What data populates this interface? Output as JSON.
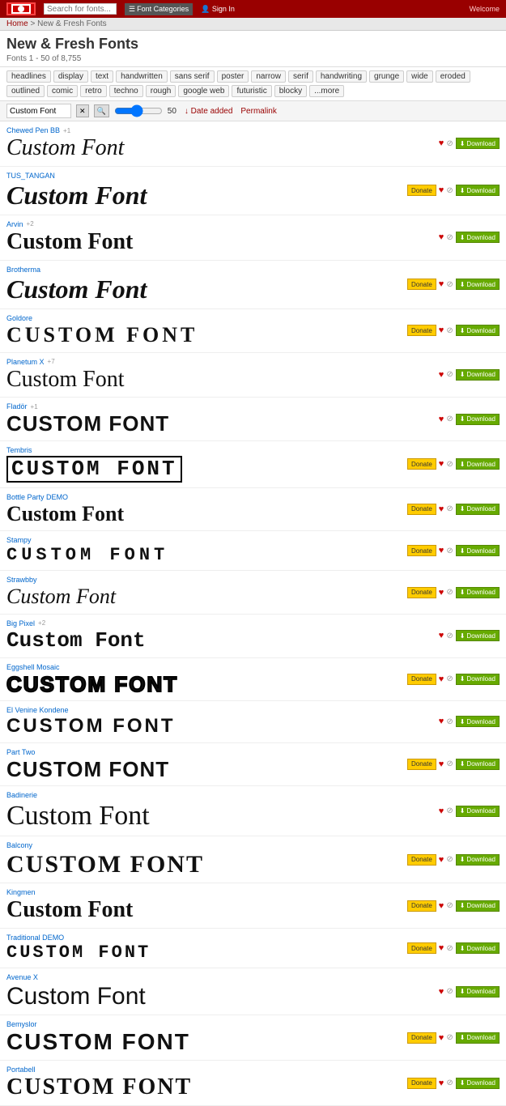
{
  "header": {
    "search_placeholder": "Search for fonts...",
    "font_categories_label": "Font Categories",
    "sign_in_label": "Sign In",
    "welcome_text": "Welcome"
  },
  "breadcrumb": {
    "home": "Home",
    "separator": " > ",
    "current": "New & Fresh Fonts"
  },
  "page": {
    "title": "New & Fresh Fonts",
    "subtitle": "Fonts 1 - 50 of 8,755"
  },
  "filters": {
    "tags": [
      "headlines",
      "display",
      "text",
      "handwritten",
      "sans serif",
      "poster",
      "narrow",
      "serif",
      "handwriting",
      "grunge",
      "wide",
      "eroded",
      "outlined",
      "comic",
      "retro",
      "techno",
      "rough",
      "google web",
      "futuristic",
      "blocky",
      "...more"
    ]
  },
  "toolbar": {
    "preview_text": "Custom Font",
    "size_label": "50",
    "sort_label": "↓ Date added",
    "permalink_label": "Permalink"
  },
  "fonts": [
    {
      "id": "chewed-pen",
      "name": "Chewed Pen BB",
      "variant": "+1",
      "preview": "Custom Font",
      "style": "chewed",
      "donate": false,
      "size": "28px"
    },
    {
      "id": "tus-tangan",
      "name": "TUS_TANGAN",
      "variant": "",
      "preview": "Custom Font",
      "style": "tangan",
      "donate": true,
      "size": "32px"
    },
    {
      "id": "arvin",
      "name": "Arvin",
      "variant": "+2",
      "preview": "Custom Font",
      "style": "arvin",
      "donate": false,
      "size": "28px"
    },
    {
      "id": "brotherma",
      "name": "Brotherma",
      "variant": "",
      "preview": "Custom Font",
      "style": "brotherma",
      "donate": true,
      "size": "32px"
    },
    {
      "id": "goldore",
      "name": "Goldore",
      "variant": "",
      "preview": "CUSTOM FONT",
      "style": "goldore",
      "donate": true,
      "size": "26px"
    },
    {
      "id": "planetum",
      "name": "Planetum X",
      "variant": "+7",
      "preview": "Custom Font",
      "style": "planetum",
      "donate": false,
      "size": "28px"
    },
    {
      "id": "flador",
      "name": "Fladör",
      "variant": "+1",
      "preview": "CUSTOM FONT",
      "style": "flador",
      "donate": false,
      "size": "26px"
    },
    {
      "id": "tembris",
      "name": "Tembris",
      "variant": "",
      "preview": "CUSTOM FONT",
      "style": "tembris",
      "donate": true,
      "size": "28px"
    },
    {
      "id": "bottle-party",
      "name": "Bottle Party DEMO",
      "variant": "",
      "preview": "Custom Font",
      "style": "bottleparty",
      "donate": true,
      "size": "26px"
    },
    {
      "id": "stampy",
      "name": "Stampy",
      "variant": "",
      "preview": "CUSTOM FONT",
      "style": "stampy",
      "donate": true,
      "size": "22px"
    },
    {
      "id": "strawbby",
      "name": "Strawbby",
      "variant": "",
      "preview": "Custom Font",
      "style": "strawbby",
      "donate": true,
      "size": "26px"
    },
    {
      "id": "big-pixel",
      "name": "Big Pixel",
      "variant": "+2",
      "preview": "Custom Font",
      "style": "bigpixel",
      "donate": false,
      "size": "26px"
    },
    {
      "id": "eggshell-mosaic",
      "name": "Eggshell Mosaic",
      "variant": "",
      "preview": "CUSTOM FONT",
      "style": "eggshell",
      "donate": true,
      "size": "26px"
    },
    {
      "id": "elvenine-kondene",
      "name": "El Venine Kondene",
      "variant": "",
      "preview": "CUSTOM FONT",
      "style": "elvenine",
      "donate": false,
      "size": "24px"
    },
    {
      "id": "part-two",
      "name": "Part Two",
      "variant": "",
      "preview": "CUSTOM FONT",
      "style": "parttwo",
      "donate": true,
      "size": "26px"
    },
    {
      "id": "badinerie",
      "name": "Badinerie",
      "variant": "",
      "preview": "Custom Font",
      "style": "badinerie",
      "donate": false,
      "size": "34px"
    },
    {
      "id": "balcony",
      "name": "Balcony",
      "variant": "",
      "preview": "CUSTOM FONT",
      "style": "balcony",
      "donate": true,
      "size": "30px"
    },
    {
      "id": "kingmen",
      "name": "Kingmen",
      "variant": "",
      "preview": "Custom Font",
      "style": "kingmen",
      "donate": true,
      "size": "28px"
    },
    {
      "id": "traditional-demo",
      "name": "Traditional DEMO",
      "variant": "",
      "preview": "CUSTOM FONT",
      "style": "traditional",
      "donate": true,
      "size": "22px"
    },
    {
      "id": "avenue",
      "name": "Avenue X",
      "variant": "",
      "preview": "Custom Font",
      "style": "avenue",
      "donate": false,
      "size": "30px"
    },
    {
      "id": "bemyslor",
      "name": "Bemyslor",
      "variant": "",
      "preview": "CUSTOM FONT",
      "style": "bemyslor",
      "donate": true,
      "size": "28px"
    },
    {
      "id": "portabell",
      "name": "Portabell",
      "variant": "",
      "preview": "CUSTOM FONT",
      "style": "portabell",
      "donate": true,
      "size": "28px"
    }
  ]
}
